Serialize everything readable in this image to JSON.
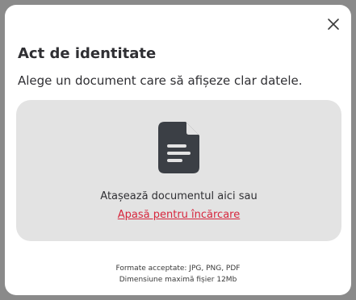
{
  "modal": {
    "title": "Act de identitate",
    "subtitle": "Alege un document care să afișeze clar datele.",
    "close_icon": "close-icon"
  },
  "dropzone": {
    "icon": "document-icon",
    "instruction": "Atașează documentul aici sau",
    "upload_link": "Apasă pentru încărcare"
  },
  "info": {
    "formats": "Formate acceptate: JPG, PNG, PDF",
    "max_size": "Dimensiune maximă fișier 12Mb"
  },
  "colors": {
    "backdrop": "#8a8a8a",
    "dropzone_bg": "#e3e3e3",
    "icon": "#3b3f45",
    "link": "#d7263d"
  }
}
